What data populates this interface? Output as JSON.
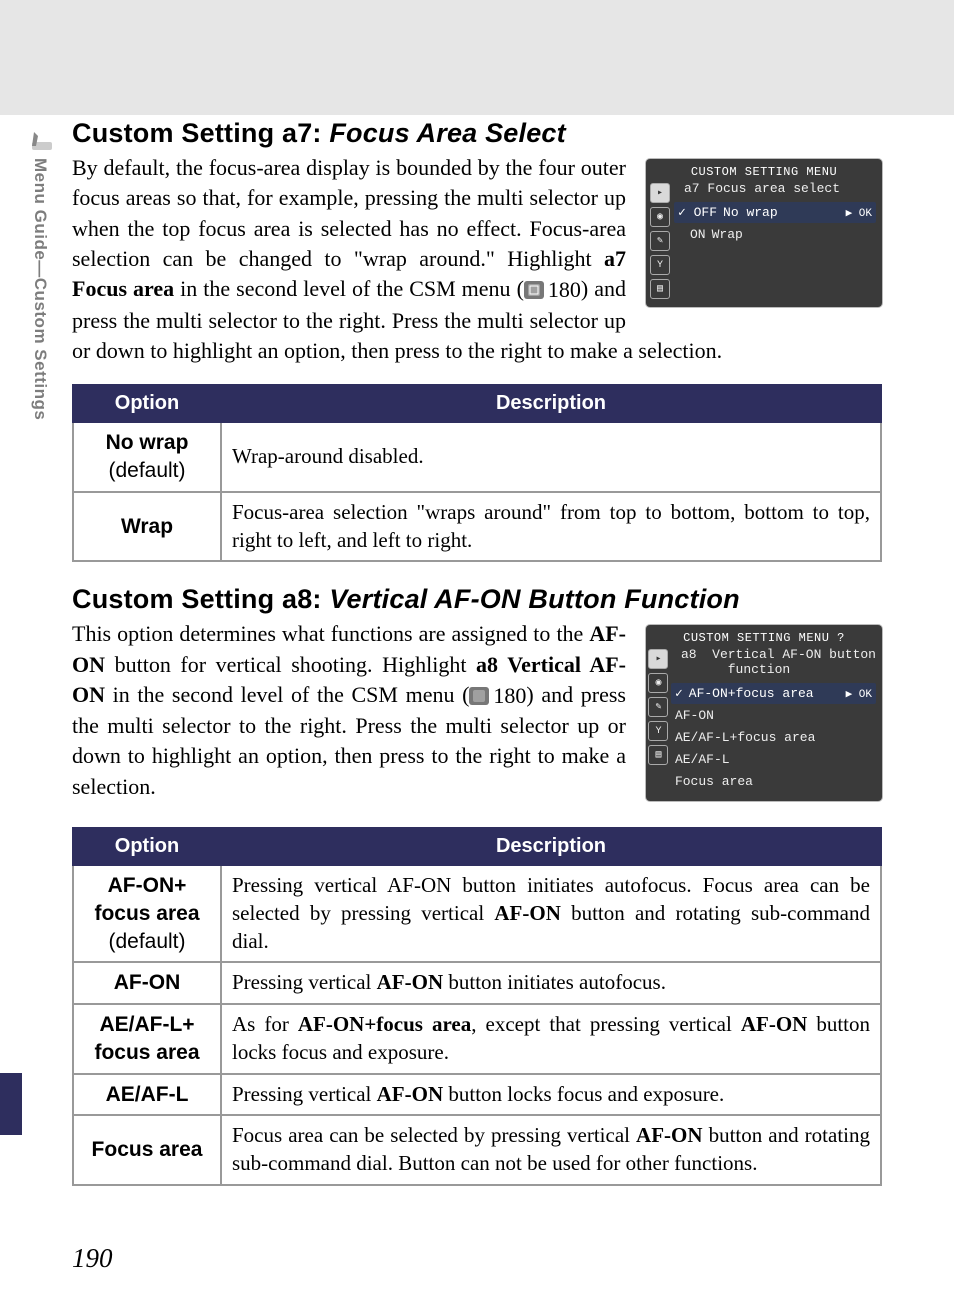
{
  "sidebar_label": "Menu Guide—Custom Settings",
  "page_number": "190",
  "a7": {
    "heading_prefix": "Custom Setting a7: ",
    "heading_title": "Focus Area Select",
    "para_pre": "By default, the focus-area display is bounded by the four outer focus areas so that, for example, pressing the multi selector up when the top focus area is selected has no effect.  Focus-area selection can be changed to \"wrap around.\"  Highlight ",
    "para_bold": "a7 Focus area",
    "para_mid1": " in the second level of the CSM menu (",
    "xref": "180",
    "para_mid2": ") and press the multi selector to the right.  Press the multi selector up or down to highlight an option, then press to the right to make a selection.",
    "table": {
      "h1": "Option",
      "h2": "Description",
      "rows": [
        {
          "opt_b": "No wrap",
          "opt_plain": "(default)",
          "desc_pre": "Wrap-around disabled.",
          "desc_b1": "",
          "desc_mid": "",
          "desc_b2": "",
          "desc_post": ""
        },
        {
          "opt_b": "Wrap",
          "opt_plain": "",
          "desc_pre": "Focus-area selection \"wraps around\" from top to bottom, bottom to top, right to left, and left to right.",
          "desc_b1": "",
          "desc_mid": "",
          "desc_b2": "",
          "desc_post": ""
        }
      ]
    },
    "lcd": {
      "title": "CUSTOM SETTING MENU",
      "sub": "a7  Focus area select",
      "l1_a": "✓ OFF",
      "l1_b": "No wrap",
      "l1_ok": "▶ OK",
      "l2_a": "ON",
      "l2_b": "Wrap"
    }
  },
  "a8": {
    "heading_prefix": "Custom Setting a8: ",
    "heading_title": "Vertical AF-ON Button Function",
    "para_pre": "This option determines what functions are assigned to the ",
    "para_b1": "AF-ON",
    "para_mid1": " button for vertical shooting.  Highlight ",
    "para_b2": "a8 Vertical AF-ON",
    "para_mid2": " in the second level of the CSM menu (",
    "xref": "180",
    "para_mid3": ") and press the multi selector to the right.  Press the multi selector up or down to highlight an option, then press to the right to make a selection.",
    "table": {
      "h1": "Option",
      "h2": "Description",
      "rows": [
        {
          "opt_b": "AF-ON+\nfocus area",
          "opt_plain": "(default)",
          "desc_pre": "Pressing vertical AF-ON button initiates autofocus.  Focus area can be selected by pressing vertical ",
          "desc_b1": "AF-ON",
          "desc_mid": " button and rotating sub-command dial.",
          "desc_b2": "",
          "desc_post": ""
        },
        {
          "opt_b": "AF-ON",
          "opt_plain": "",
          "desc_pre": "Pressing vertical ",
          "desc_b1": "AF-ON",
          "desc_mid": " button initiates autofocus.",
          "desc_b2": "",
          "desc_post": ""
        },
        {
          "opt_b": "AE/AF-L+\nfocus area",
          "opt_plain": "",
          "desc_pre": "As for ",
          "desc_b1": "AF-ON+focus area",
          "desc_mid": ", except that pressing vertical ",
          "desc_b2": "AF-ON",
          "desc_post": " button locks focus and exposure."
        },
        {
          "opt_b": "AE/AF-L",
          "opt_plain": "",
          "desc_pre": "Pressing vertical ",
          "desc_b1": "AF-ON",
          "desc_mid": " button locks focus and exposure.",
          "desc_b2": "",
          "desc_post": ""
        },
        {
          "opt_b": "Focus area",
          "opt_plain": "",
          "desc_pre": "Focus area can be selected by pressing vertical ",
          "desc_b1": "AF-ON",
          "desc_mid": " button and rotating sub-command dial.  Button can not be used for other functions.",
          "desc_b2": "",
          "desc_post": ""
        }
      ]
    },
    "lcd": {
      "title": "CUSTOM SETTING MENU",
      "sub": "a8  Vertical AF-ON button\n      function",
      "items": [
        "AF-ON+focus area",
        "AF-ON",
        "AE/AF-L+focus area",
        "AE/AF-L",
        "Focus area"
      ],
      "ok": "▶ OK"
    }
  }
}
